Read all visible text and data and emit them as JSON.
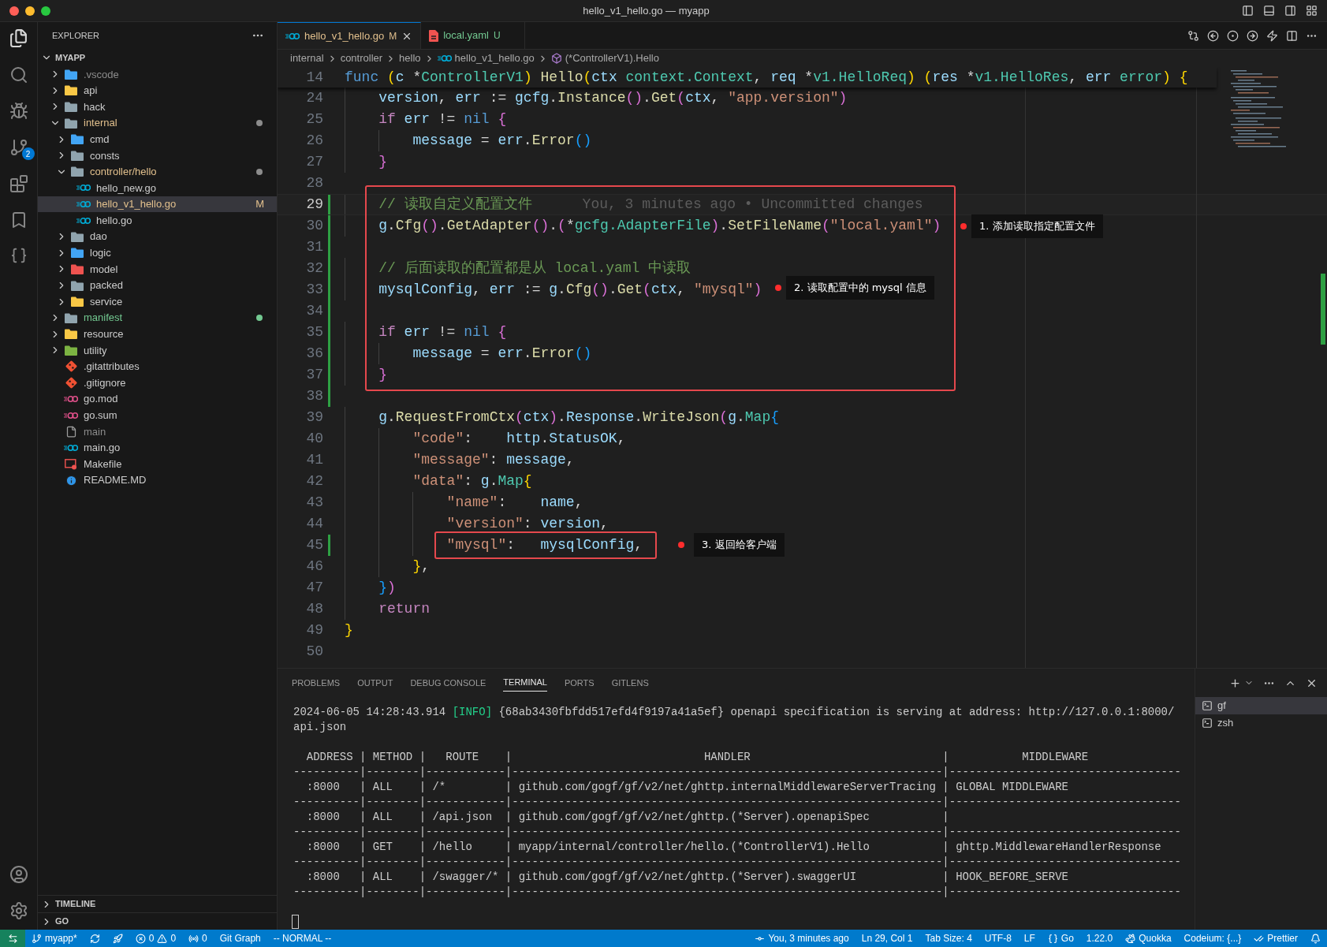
{
  "window": {
    "title": "hello_v1_hello.go — myapp"
  },
  "activity_bar": {
    "source_control_badge": "2"
  },
  "explorer": {
    "title": "EXPLORER",
    "root": "MYAPP",
    "tree": [
      {
        "name": ".vscode",
        "kind": "folder",
        "color": "#42a5f5",
        "modified": false,
        "untracked": false,
        "ignored": true,
        "expanded": false,
        "selected": false
      },
      {
        "name": "api",
        "kind": "folder",
        "color": "#f9c846",
        "modified": false,
        "untracked": false,
        "ignored": false,
        "expanded": false,
        "selected": false
      },
      {
        "name": "hack",
        "kind": "folder",
        "color": "#90a4ae",
        "modified": false,
        "untracked": false,
        "ignored": false,
        "expanded": false,
        "selected": false
      },
      {
        "name": "internal",
        "kind": "folder",
        "color": "#90a4ae",
        "modified": true,
        "untracked": false,
        "ignored": false,
        "expanded": true,
        "selected": false,
        "children": [
          {
            "name": "cmd",
            "kind": "folder",
            "color": "#42a5f5",
            "modified": false,
            "untracked": false,
            "ignored": false,
            "expanded": false,
            "selected": false
          },
          {
            "name": "consts",
            "kind": "folder",
            "color": "#90a4ae",
            "modified": false,
            "untracked": false,
            "ignored": false,
            "expanded": false,
            "selected": false
          },
          {
            "name": "controller/hello",
            "kind": "folder",
            "color": "#90a4ae",
            "modified": true,
            "untracked": false,
            "ignored": false,
            "expanded": true,
            "selected": false,
            "children": [
              {
                "name": "hello_new.go",
                "kind": "go",
                "modified": false,
                "untracked": false,
                "ignored": false,
                "selected": false
              },
              {
                "name": "hello_v1_hello.go",
                "kind": "go",
                "modified": true,
                "untracked": false,
                "ignored": false,
                "badge": "M",
                "selected": true
              },
              {
                "name": "hello.go",
                "kind": "go",
                "modified": false,
                "untracked": false,
                "ignored": false,
                "selected": false
              }
            ]
          },
          {
            "name": "dao",
            "kind": "folder",
            "color": "#90a4ae",
            "modified": false,
            "untracked": false,
            "ignored": false,
            "expanded": false,
            "selected": false
          },
          {
            "name": "logic",
            "kind": "folder",
            "color": "#42a5f5",
            "modified": false,
            "untracked": false,
            "ignored": false,
            "expanded": false,
            "selected": false
          },
          {
            "name": "model",
            "kind": "folder",
            "color": "#ef5350",
            "modified": false,
            "untracked": false,
            "ignored": false,
            "expanded": false,
            "selected": false
          },
          {
            "name": "packed",
            "kind": "folder",
            "color": "#90a4ae",
            "modified": false,
            "untracked": false,
            "ignored": false,
            "expanded": false,
            "selected": false
          },
          {
            "name": "service",
            "kind": "folder",
            "color": "#f9c846",
            "modified": false,
            "untracked": false,
            "ignored": false,
            "expanded": false,
            "selected": false
          }
        ]
      },
      {
        "name": "manifest",
        "kind": "folder",
        "color": "#90a4ae",
        "modified": false,
        "untracked": true,
        "ignored": false,
        "expanded": false,
        "selected": false
      },
      {
        "name": "resource",
        "kind": "folder",
        "color": "#f9c846",
        "modified": false,
        "untracked": false,
        "ignored": false,
        "expanded": false,
        "selected": false
      },
      {
        "name": "utility",
        "kind": "folder",
        "color": "#7cb342",
        "modified": false,
        "untracked": false,
        "ignored": false,
        "expanded": false,
        "selected": false
      },
      {
        "name": ".gitattributes",
        "kind": "git",
        "modified": false,
        "untracked": false,
        "ignored": false,
        "selected": false
      },
      {
        "name": ".gitignore",
        "kind": "git",
        "modified": false,
        "untracked": false,
        "ignored": false,
        "selected": false
      },
      {
        "name": "go.mod",
        "kind": "gomod",
        "modified": false,
        "untracked": false,
        "ignored": false,
        "selected": false
      },
      {
        "name": "go.sum",
        "kind": "gomod",
        "modified": false,
        "untracked": false,
        "ignored": false,
        "selected": false
      },
      {
        "name": "main",
        "kind": "file",
        "modified": false,
        "untracked": false,
        "ignored": true,
        "selected": false
      },
      {
        "name": "main.go",
        "kind": "go",
        "modified": false,
        "untracked": false,
        "ignored": false,
        "selected": false
      },
      {
        "name": "Makefile",
        "kind": "makefile",
        "modified": false,
        "untracked": false,
        "ignored": false,
        "selected": false
      },
      {
        "name": "README.MD",
        "kind": "info",
        "modified": false,
        "untracked": false,
        "ignored": false,
        "selected": false
      }
    ],
    "sections": [
      {
        "title": "TIMELINE"
      },
      {
        "title": "GO"
      }
    ]
  },
  "tabs": [
    {
      "label": "hello_v1_hello.go",
      "kind": "go",
      "modified": true,
      "untracked": false,
      "badge": "M",
      "selected": true
    },
    {
      "label": "local.yaml",
      "kind": "yaml",
      "modified": false,
      "untracked": true,
      "badge": "U",
      "selected": false
    }
  ],
  "breadcrumbs": [
    {
      "text": "internal",
      "kind": "plain"
    },
    {
      "text": "controller",
      "kind": "plain"
    },
    {
      "text": "hello",
      "kind": "plain"
    },
    {
      "text": "hello_v1_hello.go",
      "kind": "go"
    },
    {
      "text": "(*ControllerV1).Hello",
      "kind": "method"
    }
  ],
  "sticky_line": {
    "number": "14",
    "tokens": [
      {
        "kind": "kw",
        "text": "func"
      },
      {
        "kind": "b1",
        "text": " ("
      },
      {
        "kind": "var",
        "text": "c"
      },
      {
        "kind": "p",
        "text": " *"
      },
      {
        "kind": "type",
        "text": "ControllerV1"
      },
      {
        "kind": "b1",
        "text": ")"
      },
      {
        "kind": "fn",
        "text": " Hello"
      },
      {
        "kind": "b1",
        "text": "("
      },
      {
        "kind": "var",
        "text": "ctx"
      },
      {
        "kind": "type",
        "text": " context.Context"
      },
      {
        "kind": "p",
        "text": ", "
      },
      {
        "kind": "var",
        "text": "req"
      },
      {
        "kind": "p",
        "text": " *"
      },
      {
        "kind": "type",
        "text": "v1.HelloReq"
      },
      {
        "kind": "b1",
        "text": ")"
      },
      {
        "kind": "b1",
        "text": " ("
      },
      {
        "kind": "var",
        "text": "res"
      },
      {
        "kind": "p",
        "text": " *"
      },
      {
        "kind": "type",
        "text": "v1.HelloRes"
      },
      {
        "kind": "p",
        "text": ", "
      },
      {
        "kind": "var",
        "text": "err"
      },
      {
        "kind": "type",
        "text": " error"
      },
      {
        "kind": "b1",
        "text": ")"
      },
      {
        "kind": "b1",
        "text": " {"
      }
    ]
  },
  "code": [
    {
      "number": "24",
      "changed": false,
      "current": false,
      "tokens": [
        {
          "kind": "var",
          "text": "    version"
        },
        {
          "kind": "p",
          "text": ", "
        },
        {
          "kind": "var",
          "text": "err"
        },
        {
          "kind": "p",
          "text": " := "
        },
        {
          "kind": "var",
          "text": "gcfg"
        },
        {
          "kind": "p",
          "text": "."
        },
        {
          "kind": "fn",
          "text": "Instance"
        },
        {
          "kind": "b2",
          "text": "()"
        },
        {
          "kind": "p",
          "text": "."
        },
        {
          "kind": "fn",
          "text": "Get"
        },
        {
          "kind": "b2",
          "text": "("
        },
        {
          "kind": "var",
          "text": "ctx"
        },
        {
          "kind": "p",
          "text": ", "
        },
        {
          "kind": "str",
          "text": "\"app.version\""
        },
        {
          "kind": "b2",
          "text": ")"
        }
      ]
    },
    {
      "number": "25",
      "changed": false,
      "current": false,
      "tokens": [
        {
          "kind": "ctl",
          "text": "    if"
        },
        {
          "kind": "var",
          "text": " err"
        },
        {
          "kind": "p",
          "text": " != "
        },
        {
          "kind": "kw",
          "text": "nil"
        },
        {
          "kind": "b2",
          "text": " {"
        }
      ]
    },
    {
      "number": "26",
      "changed": false,
      "current": false,
      "tokens": [
        {
          "kind": "var",
          "text": "        message"
        },
        {
          "kind": "p",
          "text": " = "
        },
        {
          "kind": "var",
          "text": "err"
        },
        {
          "kind": "p",
          "text": "."
        },
        {
          "kind": "fn",
          "text": "Error"
        },
        {
          "kind": "b3",
          "text": "()"
        }
      ]
    },
    {
      "number": "27",
      "changed": false,
      "current": false,
      "tokens": [
        {
          "kind": "b2",
          "text": "    }"
        }
      ]
    },
    {
      "number": "28",
      "changed": false,
      "current": false
    },
    {
      "number": "29",
      "changed": true,
      "current": true,
      "blame": "You, 3 minutes ago • Uncommitted changes",
      "tokens": [
        {
          "kind": "cm",
          "text": "    // 读取自定义配置文件"
        }
      ]
    },
    {
      "number": "30",
      "changed": true,
      "current": false,
      "tokens": [
        {
          "kind": "var",
          "text": "    g"
        },
        {
          "kind": "p",
          "text": "."
        },
        {
          "kind": "fn",
          "text": "Cfg"
        },
        {
          "kind": "b2",
          "text": "()"
        },
        {
          "kind": "p",
          "text": "."
        },
        {
          "kind": "fn",
          "text": "GetAdapter"
        },
        {
          "kind": "b2",
          "text": "()"
        },
        {
          "kind": "p",
          "text": "."
        },
        {
          "kind": "b2",
          "text": "("
        },
        {
          "kind": "p",
          "text": "*"
        },
        {
          "kind": "type",
          "text": "gcfg.AdapterFile"
        },
        {
          "kind": "b2",
          "text": ")"
        },
        {
          "kind": "p",
          "text": "."
        },
        {
          "kind": "fn",
          "text": "SetFileName"
        },
        {
          "kind": "b2",
          "text": "("
        },
        {
          "kind": "str",
          "text": "\"local.yaml\""
        },
        {
          "kind": "b2",
          "text": ")"
        }
      ]
    },
    {
      "number": "31",
      "changed": true,
      "current": false
    },
    {
      "number": "32",
      "changed": true,
      "current": false,
      "tokens": [
        {
          "kind": "cm",
          "text": "    // 后面读取的配置都是从 local.yaml 中读取"
        }
      ]
    },
    {
      "number": "33",
      "changed": true,
      "current": false,
      "tokens": [
        {
          "kind": "var",
          "text": "    mysqlConfig"
        },
        {
          "kind": "p",
          "text": ", "
        },
        {
          "kind": "var",
          "text": "err"
        },
        {
          "kind": "p",
          "text": " := "
        },
        {
          "kind": "var",
          "text": "g"
        },
        {
          "kind": "p",
          "text": "."
        },
        {
          "kind": "fn",
          "text": "Cfg"
        },
        {
          "kind": "b2",
          "text": "()"
        },
        {
          "kind": "p",
          "text": "."
        },
        {
          "kind": "fn",
          "text": "Get"
        },
        {
          "kind": "b2",
          "text": "("
        },
        {
          "kind": "var",
          "text": "ctx"
        },
        {
          "kind": "p",
          "text": ", "
        },
        {
          "kind": "str",
          "text": "\"mysql\""
        },
        {
          "kind": "b2",
          "text": ")"
        }
      ]
    },
    {
      "number": "34",
      "changed": true,
      "current": false
    },
    {
      "number": "35",
      "changed": true,
      "current": false,
      "tokens": [
        {
          "kind": "ctl",
          "text": "    if"
        },
        {
          "kind": "var",
          "text": " err"
        },
        {
          "kind": "p",
          "text": " != "
        },
        {
          "kind": "kw",
          "text": "nil"
        },
        {
          "kind": "b2",
          "text": " {"
        }
      ]
    },
    {
      "number": "36",
      "changed": true,
      "current": false,
      "tokens": [
        {
          "kind": "var",
          "text": "        message"
        },
        {
          "kind": "p",
          "text": " = "
        },
        {
          "kind": "var",
          "text": "err"
        },
        {
          "kind": "p",
          "text": "."
        },
        {
          "kind": "fn",
          "text": "Error"
        },
        {
          "kind": "b3",
          "text": "()"
        }
      ]
    },
    {
      "number": "37",
      "changed": true,
      "current": false,
      "tokens": [
        {
          "kind": "b2",
          "text": "    }"
        }
      ]
    },
    {
      "number": "38",
      "changed": true,
      "current": false
    },
    {
      "number": "39",
      "changed": false,
      "current": false,
      "tokens": [
        {
          "kind": "var",
          "text": "    g"
        },
        {
          "kind": "p",
          "text": "."
        },
        {
          "kind": "fn",
          "text": "RequestFromCtx"
        },
        {
          "kind": "b2",
          "text": "("
        },
        {
          "kind": "var",
          "text": "ctx"
        },
        {
          "kind": "b2",
          "text": ")"
        },
        {
          "kind": "p",
          "text": "."
        },
        {
          "kind": "var",
          "text": "Response"
        },
        {
          "kind": "p",
          "text": "."
        },
        {
          "kind": "fn",
          "text": "WriteJson"
        },
        {
          "kind": "b2",
          "text": "("
        },
        {
          "kind": "var",
          "text": "g"
        },
        {
          "kind": "p",
          "text": "."
        },
        {
          "kind": "type",
          "text": "Map"
        },
        {
          "kind": "b3",
          "text": "{"
        }
      ]
    },
    {
      "number": "40",
      "changed": false,
      "current": false,
      "tokens": [
        {
          "kind": "str",
          "text": "        \"code\""
        },
        {
          "kind": "p",
          "text": ":    "
        },
        {
          "kind": "var",
          "text": "http"
        },
        {
          "kind": "p",
          "text": "."
        },
        {
          "kind": "var",
          "text": "StatusOK"
        },
        {
          "kind": "p",
          "text": ","
        }
      ]
    },
    {
      "number": "41",
      "changed": false,
      "current": false,
      "tokens": [
        {
          "kind": "str",
          "text": "        \"message\""
        },
        {
          "kind": "p",
          "text": ": "
        },
        {
          "kind": "var",
          "text": "message"
        },
        {
          "kind": "p",
          "text": ","
        }
      ]
    },
    {
      "number": "42",
      "changed": false,
      "current": false,
      "tokens": [
        {
          "kind": "str",
          "text": "        \"data\""
        },
        {
          "kind": "p",
          "text": ": "
        },
        {
          "kind": "var",
          "text": "g"
        },
        {
          "kind": "p",
          "text": "."
        },
        {
          "kind": "type",
          "text": "Map"
        },
        {
          "kind": "b1",
          "text": "{"
        }
      ]
    },
    {
      "number": "43",
      "changed": false,
      "current": false,
      "tokens": [
        {
          "kind": "str",
          "text": "            \"name\""
        },
        {
          "kind": "p",
          "text": ":    "
        },
        {
          "kind": "var",
          "text": "name"
        },
        {
          "kind": "p",
          "text": ","
        }
      ]
    },
    {
      "number": "44",
      "changed": false,
      "current": false,
      "tokens": [
        {
          "kind": "str",
          "text": "            \"version\""
        },
        {
          "kind": "p",
          "text": ": "
        },
        {
          "kind": "var",
          "text": "version"
        },
        {
          "kind": "p",
          "text": ","
        }
      ]
    },
    {
      "number": "45",
      "changed": true,
      "current": false,
      "tokens": [
        {
          "kind": "str",
          "text": "            \"mysql\""
        },
        {
          "kind": "p",
          "text": ":   "
        },
        {
          "kind": "var",
          "text": "mysqlConfig"
        },
        {
          "kind": "p",
          "text": ","
        }
      ]
    },
    {
      "number": "46",
      "changed": false,
      "current": false,
      "tokens": [
        {
          "kind": "b1",
          "text": "        }"
        },
        {
          "kind": "p",
          "text": ","
        }
      ]
    },
    {
      "number": "47",
      "changed": false,
      "current": false,
      "tokens": [
        {
          "kind": "b3",
          "text": "    }"
        },
        {
          "kind": "b2",
          "text": ")"
        }
      ]
    },
    {
      "number": "48",
      "changed": false,
      "current": false,
      "tokens": [
        {
          "kind": "ctl",
          "text": "    return"
        }
      ]
    },
    {
      "number": "49",
      "changed": false,
      "current": false,
      "tokens": [
        {
          "kind": "b1",
          "text": "}"
        }
      ]
    },
    {
      "number": "50",
      "changed": false,
      "current": false
    }
  ],
  "callouts": [
    {
      "text": "1. 添加读取指定配置文件"
    },
    {
      "text": "2. 读取配置中的 mysql 信息"
    },
    {
      "text": "3. 返回给客户端"
    }
  ],
  "panel": {
    "tabs": [
      {
        "label": "PROBLEMS",
        "selected": false
      },
      {
        "label": "OUTPUT",
        "selected": false
      },
      {
        "label": "DEBUG CONSOLE",
        "selected": false
      },
      {
        "label": "TERMINAL",
        "selected": true
      },
      {
        "label": "PORTS",
        "selected": false
      },
      {
        "label": "GITLENS",
        "selected": false
      }
    ],
    "log": {
      "timestamp": "2024-06-05 14:28:43.914",
      "level": "[INFO]",
      "message": "{68ab3430fbfdd517efd4f9197a41a5ef} openapi specification is serving at address: http://127.0.0.1:8000/api.json"
    },
    "table_lines": [
      "  ADDRESS | METHOD |   ROUTE    |                             HANDLER                             |           MIDDLEWARE",
      "----------|--------|------------|-----------------------------------------------------------------|-----------------------------------",
      "  :8000   | ALL    | /*         | github.com/gogf/gf/v2/net/ghttp.internalMiddlewareServerTracing | GLOBAL MIDDLEWARE",
      "----------|--------|------------|-----------------------------------------------------------------|-----------------------------------",
      "  :8000   | ALL    | /api.json  | github.com/gogf/gf/v2/net/ghttp.(*Server).openapiSpec           |",
      "----------|--------|------------|-----------------------------------------------------------------|-----------------------------------",
      "  :8000   | GET    | /hello     | myapp/internal/controller/hello.(*ControllerV1).Hello           | ghttp.MiddlewareHandlerResponse",
      "----------|--------|------------|-----------------------------------------------------------------|-----------------------------------",
      "  :8000   | ALL    | /swagger/* | github.com/gogf/gf/v2/net/ghttp.(*Server).swaggerUI             | HOOK_BEFORE_SERVE",
      "----------|--------|------------|-----------------------------------------------------------------|-----------------------------------"
    ],
    "terminals": [
      {
        "name": "gf",
        "selected": true
      },
      {
        "name": "zsh",
        "selected": false
      }
    ]
  },
  "status_bar": {
    "left": [
      {
        "kind": "remote"
      },
      {
        "kind": "branch",
        "text": "myapp*"
      },
      {
        "kind": "sync"
      },
      {
        "kind": "rocket"
      },
      {
        "kind": "problems",
        "errors": "0",
        "warnings": "0"
      },
      {
        "kind": "ports",
        "text": "0"
      },
      {
        "kind": "plain",
        "text": "Git Graph"
      },
      {
        "kind": "plain",
        "text": "-- NORMAL --"
      }
    ],
    "right": [
      {
        "kind": "commit",
        "text": "You, 3 minutes ago"
      },
      {
        "kind": "plain",
        "text": "Ln 29, Col 1"
      },
      {
        "kind": "plain",
        "text": "Tab Size: 4"
      },
      {
        "kind": "plain",
        "text": "UTF-8"
      },
      {
        "kind": "plain",
        "text": "LF"
      },
      {
        "kind": "braces",
        "text": "Go"
      },
      {
        "kind": "plain",
        "text": "1.22.0"
      },
      {
        "kind": "quokka",
        "text": "Quokka"
      },
      {
        "kind": "plain",
        "text": "Codeium: {...}"
      },
      {
        "kind": "checks",
        "text": "Prettier"
      },
      {
        "kind": "bell"
      }
    ]
  }
}
